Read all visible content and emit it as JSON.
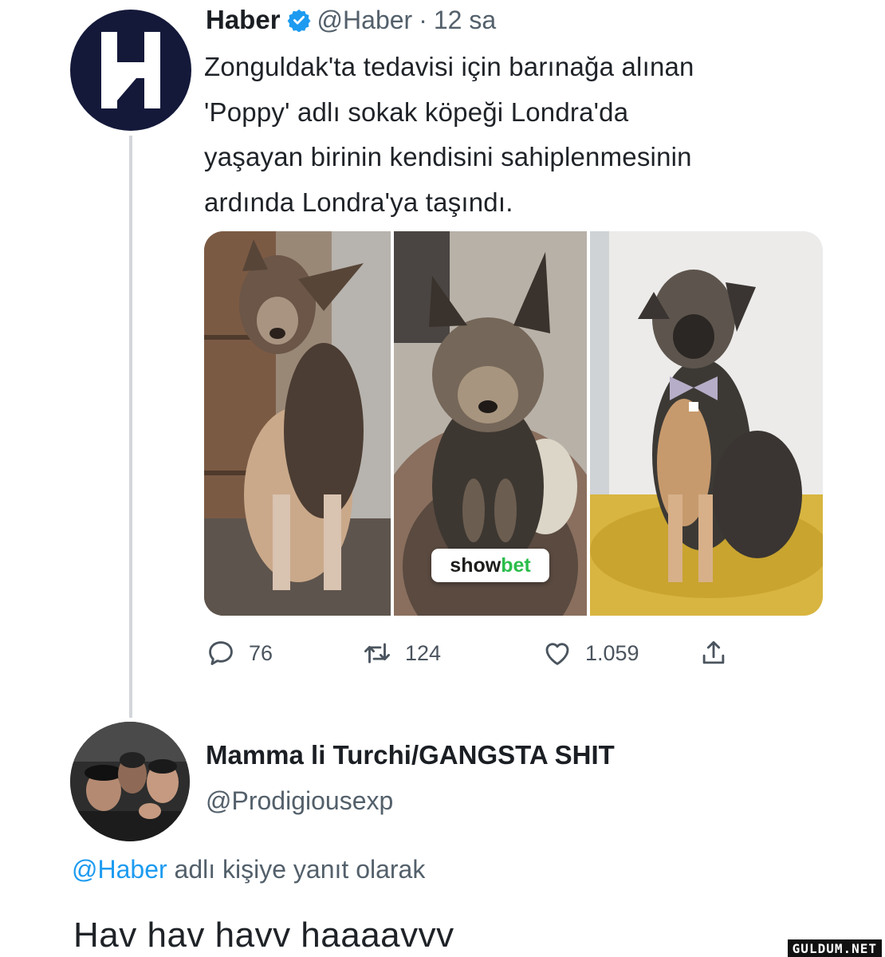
{
  "tweet": {
    "avatar_icon": "haber-logo-icon",
    "author_name": "Haber",
    "verified_icon": "verified-badge-icon",
    "handle": "@Haber",
    "separator": "·",
    "time": "12 sa",
    "text_lines": [
      "Zonguldak'ta tedavisi için barınağa alınan",
      "'Poppy' adlı sokak köpeği Londra'da",
      "yaşayan birinin kendisini sahiplenmesinin",
      "ardında Londra'ya taşındı."
    ],
    "photos": [
      "dog-photo-1",
      "dog-photo-2",
      "dog-photo-3"
    ],
    "watermark": {
      "part1": "show",
      "part2": "bet"
    },
    "actions": {
      "reply": {
        "icon": "reply-icon",
        "count": "76"
      },
      "retweet": {
        "icon": "retweet-icon",
        "count": "124"
      },
      "like": {
        "icon": "heart-icon",
        "count": "1.059"
      },
      "share": {
        "icon": "share-icon"
      }
    }
  },
  "reply": {
    "avatar_icon": "group-photo-avatar",
    "author_name": "Mamma li Turchi/GANGSTA SHIT",
    "handle": "@Prodigiousexp",
    "context_mention": "@Haber",
    "context_text": " adlı kişiye yanıt olarak",
    "text": "Hav hav havv haaaavvv"
  },
  "site_watermark": "GULDUM.NET",
  "colors": {
    "link": "#1d9bf0",
    "secondary_text": "#53606b",
    "brand_green": "#2bbd4a",
    "haber_navy": "#14193a"
  }
}
